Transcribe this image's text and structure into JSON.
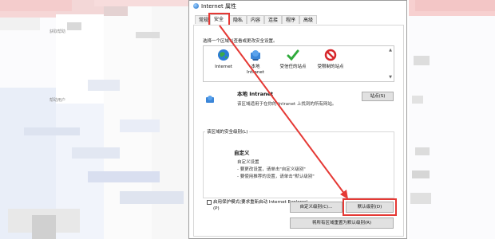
{
  "background": {
    "left_caption": "获取帮助",
    "left_caption_2": "帮助用户"
  },
  "dialog": {
    "title": "Internet 属性",
    "tabs": [
      {
        "label": "常规"
      },
      {
        "label": "安全"
      },
      {
        "label": "隐私"
      },
      {
        "label": "内容"
      },
      {
        "label": "连接"
      },
      {
        "label": "程序"
      },
      {
        "label": "高级"
      }
    ],
    "active_tab": "安全",
    "zone_prompt": "选择一个区域以查看或更改安全设置。",
    "zones": [
      {
        "label": "Internet",
        "icon": "globe-icon"
      },
      {
        "label": "本地 Intranet",
        "icon": "intranet-icon"
      },
      {
        "label": "受信任的站点",
        "icon": "check-icon"
      },
      {
        "label": "受限制的站点",
        "icon": "no-entry-icon"
      }
    ],
    "selected_zone": {
      "title": "本地 Intranet",
      "description": "该区域适用于在你的 Intranet 上找到的所有网站。",
      "sites_button": "站点(S)"
    },
    "security_level": {
      "group_label": "该区域的安全级别(L)",
      "level_title": "自定义",
      "lines": [
        "自定义设置",
        "- 要更改设置，请单击\"自定义级别\"",
        "- 要使用推荐的设置，请单击\"默认级别\""
      ]
    },
    "protected_mode": {
      "label": "启用保护模式(要求重新启动 Internet Explorer)(P)",
      "checked": false
    },
    "buttons": {
      "custom_level": "自定义级别(C)...",
      "default_level": "默认级别(D)",
      "reset_all": "将所有区域重置为默认级别(R)"
    },
    "highlight_color": "#e53935"
  }
}
